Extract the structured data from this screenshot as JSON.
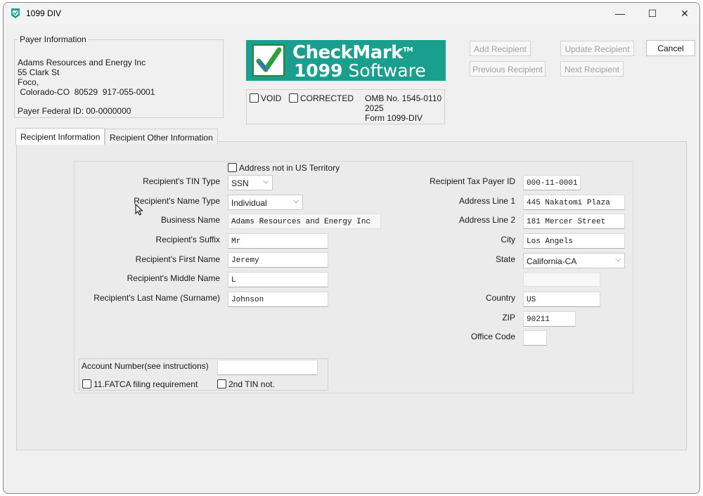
{
  "window": {
    "title": "1099 DIV",
    "controls": {
      "minimize": "—",
      "maximize": "☐",
      "close": "✕"
    }
  },
  "payer": {
    "legend": "Payer Information",
    "name": "Adams Resources and Energy Inc",
    "address1": "55 Clark St",
    "address2": "Foco,",
    "address3": " Colorado-CO  80529  917-055-0001",
    "federal_id": "Payer Federal ID: 00-0000000"
  },
  "logo": {
    "line1": "CheckMark",
    "tm": "TM",
    "line2_bold": "1099",
    "line2_rest": " Software"
  },
  "form_info": {
    "void_label": "VOID",
    "corrected_label": "CORRECTED",
    "omb": "OMB No. 1545-0110",
    "year": "2025",
    "form": "Form 1099-DIV"
  },
  "toolbar": {
    "add": "Add Recipient",
    "update": "Update Recipient",
    "cancel": "Cancel",
    "previous": "Previous Recipient",
    "next": "Next Recipient"
  },
  "tabs": [
    {
      "label": "Recipient Information",
      "active": true
    },
    {
      "label": "Recipient Other Information",
      "active": false
    }
  ],
  "recipient": {
    "address_not_us_label": "Address not in US Territory",
    "tin_type_label": "Recipient's TIN Type",
    "tin_type_value": "SSN",
    "name_type_label": "Recipient's Name Type",
    "name_type_value": "Individual",
    "business_name_label": "Business Name",
    "business_name_value": "Adams Resources and Energy Inc",
    "suffix_label": "Recipient's Suffix",
    "suffix_value": "Mr",
    "first_name_label": "Recipient's First Name",
    "first_name_value": "Jeremy",
    "middle_name_label": "Recipient's Middle Name",
    "middle_name_value": "L",
    "last_name_label": "Recipient's Last Name (Surname)",
    "last_name_value": "Johnson",
    "tax_id_label": "Recipient Tax Payer ID",
    "tax_id_value": "000-11-0001",
    "address1_label": "Address Line 1",
    "address1_value": "445 Nakatomi Plaza",
    "address2_label": "Address Line 2",
    "address2_value": "181 Mercer Street",
    "city_label": "City",
    "city_value": "Los Angels",
    "state_label": "State",
    "state_value": "California-CA",
    "extra_value": "",
    "country_label": "Country",
    "country_value": "US",
    "zip_label": "ZIP",
    "zip_value": "90211",
    "office_code_label": "Office Code",
    "office_code_value": "",
    "account_label": "Account Number(see instructions)",
    "account_value": "",
    "fatca_label": "11.FATCA filing requirement",
    "second_tin_label": "2nd TIN not."
  },
  "colors": {
    "logo_bg": "#1a9e8e",
    "window_bg": "#f0f0f0",
    "panel_bg": "#ebebeb"
  }
}
